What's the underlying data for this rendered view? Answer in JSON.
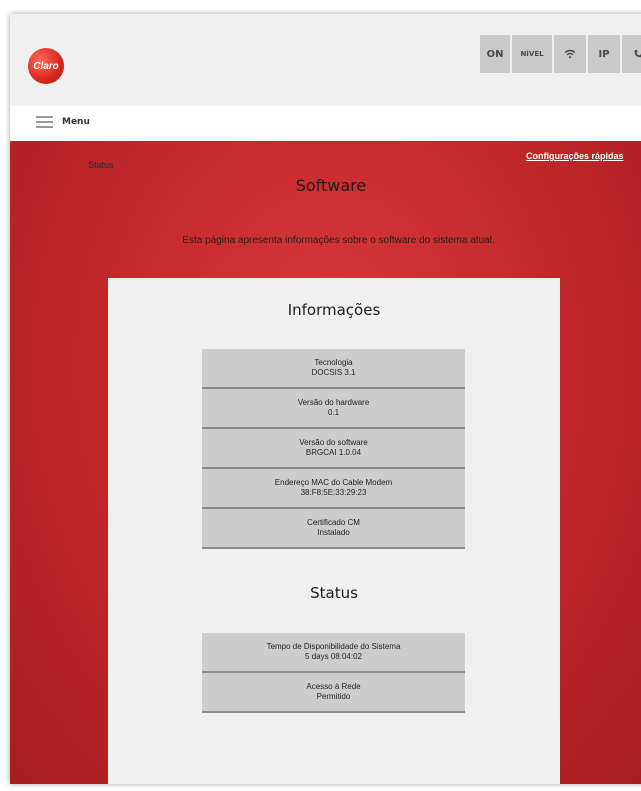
{
  "header": {
    "logo_text": "Claro",
    "status_items": {
      "on": "ON",
      "nivel": "NÍVEL",
      "wifi_icon": "wifi-icon",
      "ip": "IP",
      "phone_icon": "phone-icon"
    }
  },
  "menu": {
    "label": "Menu"
  },
  "breadcrumb": "Status",
  "quick_link": "Configurações rápidas",
  "page": {
    "title": "Software",
    "description": "Esta página apresenta informações sobre o software do sistema atual."
  },
  "sections": {
    "informacoes": {
      "title": "Informações",
      "rows": [
        {
          "label": "Tecnologia",
          "value": "DOCSIS 3.1"
        },
        {
          "label": "Versão do hardware",
          "value": "0.1"
        },
        {
          "label": "Versão do software",
          "value": "BRGCAI 1.0.04"
        },
        {
          "label": "Endereço MAC do Cable Modem",
          "value": "38:F8:5E:33:29:23"
        },
        {
          "label": "Certificado CM",
          "value": "Instalado"
        }
      ]
    },
    "status": {
      "title": "Status",
      "rows": [
        {
          "label": "Tempo de Disponibilidade do Sistema",
          "value": "5 days 08:04:02"
        },
        {
          "label": "Acesso à Rede",
          "value": "Permitido"
        }
      ]
    }
  },
  "colors": {
    "brand_red": "#c52a2c",
    "panel_bg": "#f0f0f0",
    "row_bg": "#cdcdcd"
  }
}
